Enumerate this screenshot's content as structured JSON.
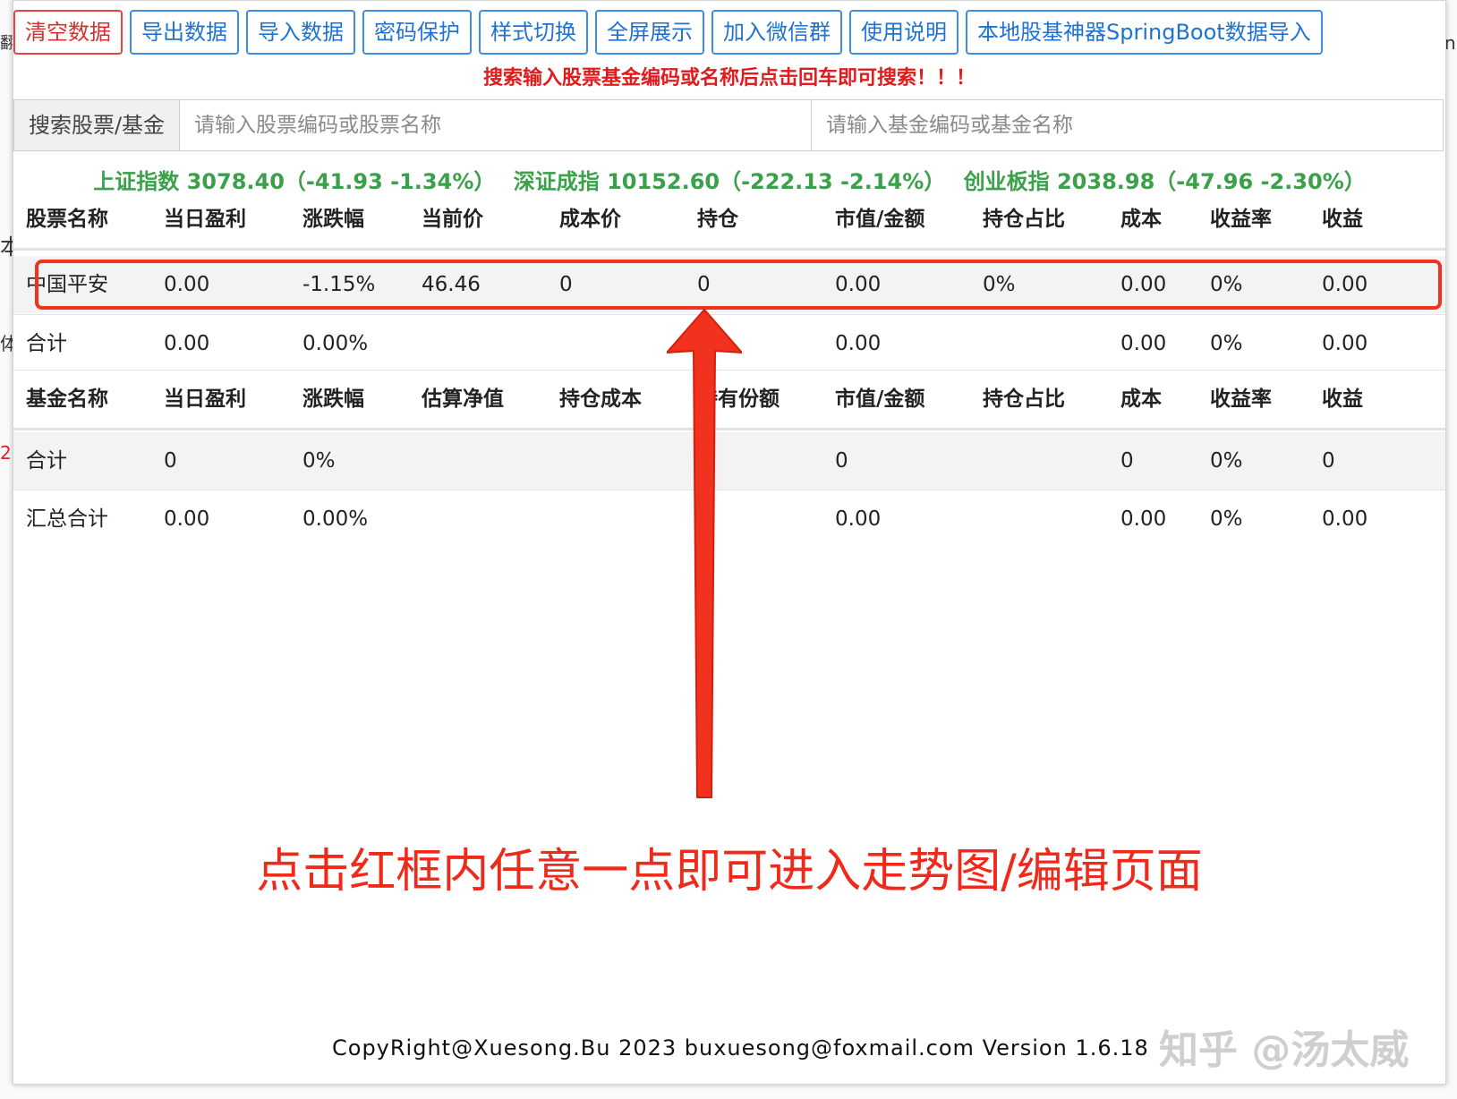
{
  "toolbar": {
    "buttons": [
      "清空数据",
      "导出数据",
      "导入数据",
      "密码保护",
      "样式切换",
      "全屏展示",
      "加入微信群",
      "使用说明",
      "本地股基神器SpringBoot数据导入"
    ]
  },
  "hint": "搜索输入股票基金编码或名称后点击回车即可搜索！！！",
  "search": {
    "label": "搜索股票/基金",
    "stock_placeholder": "请输入股票编码或股票名称",
    "fund_placeholder": "请输入基金编码或基金名称"
  },
  "indices": [
    "上证指数 3078.40（-41.93  -1.34%）",
    "深证成指 10152.60（-222.13  -2.14%）",
    "创业板指 2038.98（-47.96  -2.30%）"
  ],
  "stock_table": {
    "headers": [
      "股票名称",
      "当日盈利",
      "涨跌幅",
      "当前价",
      "成本价",
      "持仓",
      "市值/金额",
      "持仓占比",
      "成本",
      "收益率",
      "收益"
    ],
    "rows": [
      [
        "中国平安",
        "0.00",
        "-1.15%",
        "46.46",
        "0",
        "0",
        "0.00",
        "0%",
        "0.00",
        "0%",
        "0.00"
      ]
    ],
    "total": [
      "合计",
      "0.00",
      "0.00%",
      "",
      "",
      "",
      "0.00",
      "",
      "0.00",
      "0%",
      "0.00"
    ]
  },
  "fund_table": {
    "headers": [
      "基金名称",
      "当日盈利",
      "涨跌幅",
      "估算净值",
      "持仓成本",
      "持有份额",
      "市值/金额",
      "持仓占比",
      "成本",
      "收益率",
      "收益"
    ],
    "total": [
      "合计",
      "0",
      "0%",
      "",
      "",
      "",
      "0",
      "",
      "0",
      "0%",
      "0"
    ]
  },
  "grand_total": [
    "汇总合计",
    "0.00",
    "0.00%",
    "",
    "",
    "",
    "0.00",
    "",
    "0.00",
    "0%",
    "0.00"
  ],
  "annotation": "点击红框内任意一点即可进入走势图/编辑页面",
  "footer": "CopyRight@Xuesong.Bu 2023 buxuesong@foxmail.com Version 1.6.18",
  "watermark": "知乎 @汤太威",
  "background_fragments": {
    "left_1": "翻",
    "left_2": "本",
    "left_3": "体",
    "left_4": "2",
    "right_1": "n"
  },
  "colors": {
    "primary_border": "#3a8ee6",
    "danger": "#e04646",
    "index_green": "#3aa049",
    "annotation_red": "#ef2a1a"
  }
}
